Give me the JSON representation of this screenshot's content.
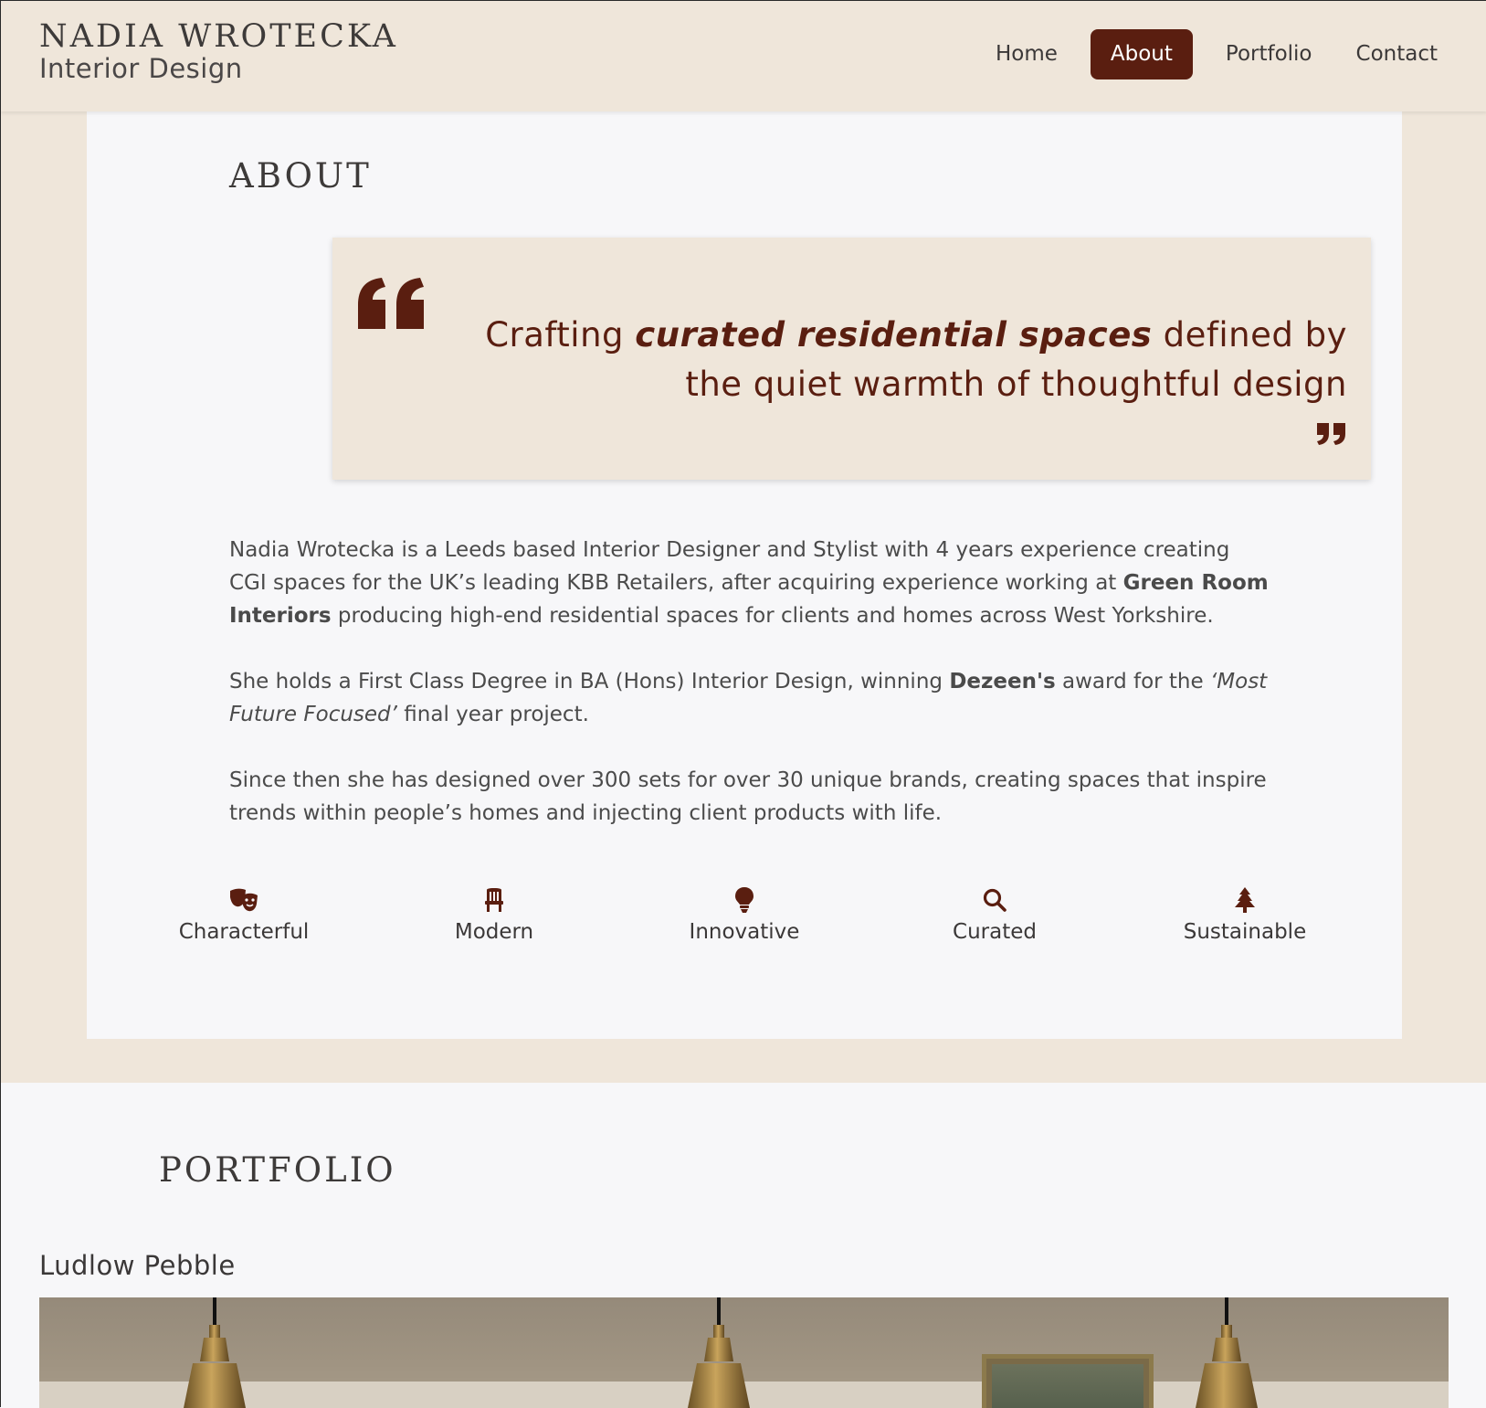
{
  "header": {
    "brand_name": "NADIA WROTECKA",
    "brand_sub": "Interior Design",
    "nav": [
      {
        "label": "Home",
        "active": false
      },
      {
        "label": "About",
        "active": true
      },
      {
        "label": "Portfolio",
        "active": false
      },
      {
        "label": "Contact",
        "active": false
      }
    ]
  },
  "about": {
    "title": "ABOUT",
    "quote": {
      "before": "Crafting ",
      "emphasis": "curated residential spaces",
      "after": " defined by the quiet warmth of thoughtful design"
    },
    "bio": {
      "p1_a": "Nadia Wrotecka is a Leeds based Interior Designer and Stylist with 4 years experience creating CGI spaces for the UK’s leading KBB Retailers, after acquiring experience working at ",
      "p1_bold": "Green Room Interiors",
      "p1_b": " producing high-end residential spaces for clients and homes across West Yorkshire.",
      "p2_a": "She holds a First Class Degree in BA (Hons) Interior Design, winning ",
      "p2_bold": "Dezeen's",
      "p2_b": " award for the ",
      "p2_italic": "‘Most Future Focused’",
      "p2_c": " final year project.",
      "p3": "Since then she has designed over 300 sets for over 30 unique brands, creating spaces that inspire trends within people’s homes and injecting client products with life."
    },
    "values": [
      {
        "label": "Characterful",
        "icon": "theater-masks-icon"
      },
      {
        "label": "Modern",
        "icon": "chair-icon"
      },
      {
        "label": "Innovative",
        "icon": "lightbulb-icon"
      },
      {
        "label": "Curated",
        "icon": "search-icon"
      },
      {
        "label": "Sustainable",
        "icon": "tree-icon"
      }
    ]
  },
  "portfolio": {
    "title": "PORTFOLIO",
    "projects": [
      {
        "title": "Ludlow Pebble"
      }
    ]
  },
  "colors": {
    "accent": "#5a1e10",
    "beige": "#efe6da",
    "card": "#f7f7f9"
  }
}
